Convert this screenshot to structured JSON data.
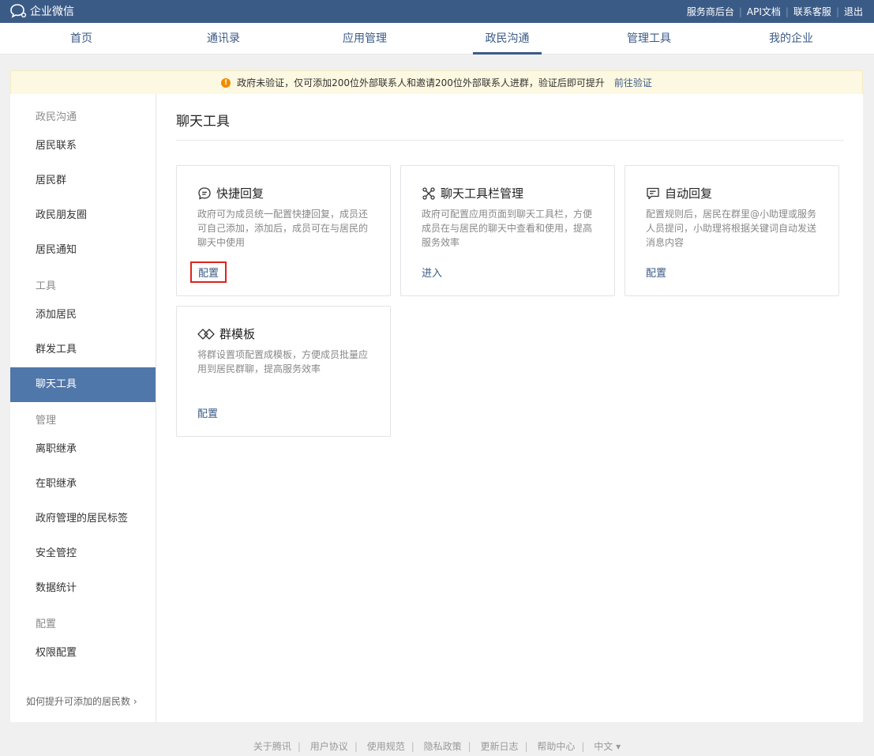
{
  "topbar": {
    "logo_text": "企业微信",
    "links": [
      "服务商后台",
      "API文档",
      "联系客服",
      "退出"
    ]
  },
  "nav": {
    "items": [
      "首页",
      "通讯录",
      "应用管理",
      "政民沟通",
      "管理工具",
      "我的企业"
    ],
    "active": "政民沟通"
  },
  "notice": {
    "text": "政府未验证，仅可添加200位外部联系人和邀请200位外部联系人进群，验证后即可提升",
    "link": "前往验证"
  },
  "sidebar": {
    "groups": [
      "政民沟通",
      "工具",
      "管理",
      "配置"
    ],
    "items": [
      "居民联系",
      "居民群",
      "政民朋友圈",
      "居民通知",
      "添加居民",
      "群发工具",
      "聊天工具",
      "离职继承",
      "在职继承",
      "政府管理的居民标签",
      "安全管控",
      "数据统计",
      "权限配置"
    ],
    "active": "聊天工具",
    "help": "如何提升可添加的居民数"
  },
  "main": {
    "title": "聊天工具",
    "cards": [
      {
        "icon": "chat-bubble-icon",
        "title": "快捷回复",
        "desc": "政府可为成员统一配置快捷回复，成员还可自己添加，添加后，成员可在与居民的聊天中使用",
        "link": "配置"
      },
      {
        "icon": "toolbar-cross-icon",
        "title": "聊天工具栏管理",
        "desc": "政府可配置应用页面到聊天工具栏，方便成员在与居民的聊天中查看和使用，提高服务效率",
        "link": "进入"
      },
      {
        "icon": "auto-reply-icon",
        "title": "自动回复",
        "desc": "配置规则后，居民在群里@小助理或服务人员提问，小助理将根据关键词自动发送消息内容",
        "link": "配置"
      },
      {
        "icon": "template-diamond-icon",
        "title": "群模板",
        "desc": "将群设置项配置成模板，方便成员批量应用到居民群聊，提高服务效率",
        "link": "配置"
      }
    ]
  },
  "footer": {
    "links": [
      "关于腾讯",
      "用户协议",
      "使用规范",
      "隐私政策",
      "更新日志",
      "帮助中心"
    ],
    "lang": "中文 ▾"
  }
}
